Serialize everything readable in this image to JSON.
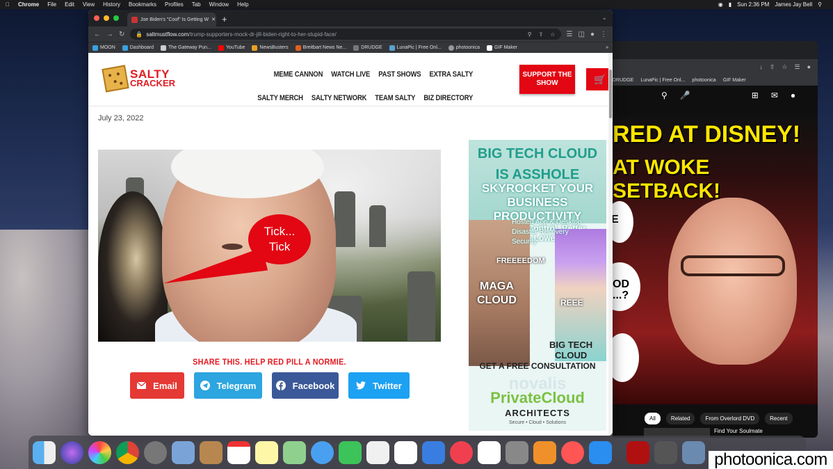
{
  "menubar": {
    "app": "Chrome",
    "items": [
      "File",
      "Edit",
      "View",
      "History",
      "Bookmarks",
      "Profiles",
      "Tab",
      "Window",
      "Help"
    ],
    "clock": "Sun 2:36 PM",
    "user": "James Jay Bell"
  },
  "browser": {
    "tab_title": "Joe Biden's \"Coof\" Is Getting W",
    "url_domain": "saltmustflow.com",
    "url_path": "/trump-supporters-mock-dr-jill-biden-right-to-her-stupid-face/",
    "bookmarks": [
      "MOON",
      "Dashboard",
      "The Gateway Pun...",
      "YouTube",
      "NewsBusters",
      "Breitbart News Ne...",
      "DRUDGE",
      "LunaPic | Free Onl...",
      "photoonica",
      "GIF Maker"
    ]
  },
  "site": {
    "logo_line1": "SALTY",
    "logo_line2": "CRACKER",
    "nav": [
      "MEME CANNON",
      "WATCH LIVE",
      "PAST SHOWS",
      "EXTRA SALTY",
      "SALTY MERCH",
      "SALTY NETWORK",
      "TEAM SALTY",
      "BIZ DIRECTORY"
    ],
    "support_label": "SUPPORT THE SHOW",
    "date": "July 23, 2022",
    "bubble_line1": "Tick...",
    "bubble_line2": "Tick",
    "share_title": "SHARE THIS. HELP RED PILL A NORMIE.",
    "share_buttons": [
      "Email",
      "Telegram",
      "Facebook",
      "Twitter"
    ]
  },
  "ad": {
    "headline1": "BIG TECH CLOUD",
    "headline2": "IS ASSHOLE",
    "headline3": "SKYROCKET YOUR BUSINESS",
    "headline4": "PRODUCTIVITY",
    "sub1": "Get More Control, Better",
    "sub2": "Support & Lower Costs",
    "bullets": [
      "Hosted App & Desktop",
      "Disaster Recovery",
      "Security"
    ],
    "label_freedom": "FREEEEDOM",
    "label_maga": "MAGA",
    "label_cloud": "CLOUD",
    "label_reee": "REEE",
    "label_bigtech": "BIG TECH",
    "label_cloud2": "CLOUD",
    "cta": "GET A FREE CONSULTATION",
    "brand": "novalis",
    "product": "PrivateCloud",
    "product2": "ARCHITECTS",
    "tagline": "Secure • Cloud • Solutions"
  },
  "youtube": {
    "bookmarks": [
      "DRUDGE",
      "LunaPic | Free Onl...",
      "photoonica",
      "GIF Maker"
    ],
    "thumb_line1": "RED AT DISNEY!",
    "thumb_line2": "AT WOKE SETBACK!",
    "cloud1": "E",
    "cloud2": "OD",
    "cloud3": "...?",
    "chips": [
      "All",
      "Related",
      "From Overlord DVD",
      "Recent"
    ],
    "related_title": "Find Your Soulmate"
  },
  "watermark": "photoonica.com",
  "colors": {
    "brand_red": "#e30613",
    "email": "#e53935",
    "telegram": "#2ca5e0",
    "facebook": "#3b5998",
    "twitter": "#1da1f2"
  }
}
